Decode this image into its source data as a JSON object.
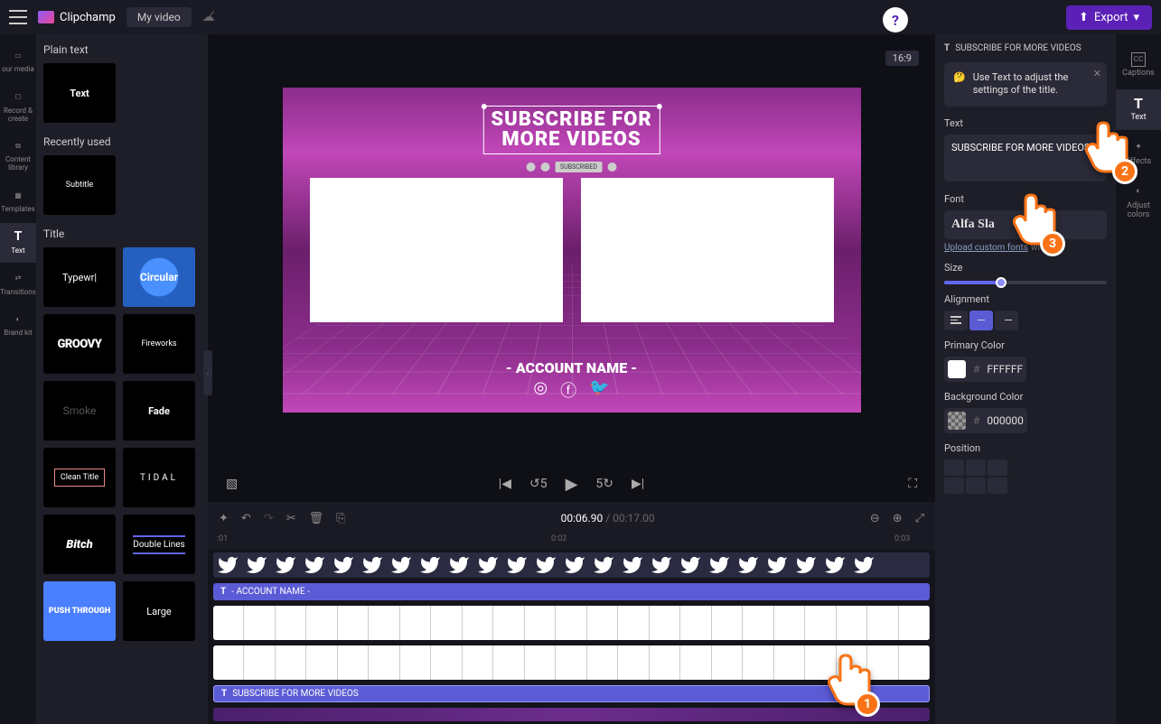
{
  "app_name": "Clipchamp",
  "video_name": "My video",
  "export_label": "Export",
  "rail": [
    {
      "icon": "film",
      "label": "our media"
    },
    {
      "icon": "video",
      "label": "Record & create"
    },
    {
      "icon": "library",
      "label": "Content library"
    },
    {
      "icon": "grid",
      "label": "Templates"
    },
    {
      "icon": "T",
      "label": "Text",
      "active": true
    },
    {
      "icon": "arrows",
      "label": "Transitions"
    },
    {
      "icon": "palette",
      "label": "Brand kit"
    }
  ],
  "left_panel": {
    "sections": {
      "plain": {
        "title": "Plain text",
        "items": [
          {
            "label": "Text"
          }
        ]
      },
      "recent": {
        "title": "Recently used",
        "items": [
          {
            "label": "Subtitle"
          }
        ]
      },
      "title": {
        "title": "Title",
        "items": [
          {
            "label": "Typewr",
            "cls": ""
          },
          {
            "label": "Circular",
            "cls": "circular"
          },
          {
            "label": "GROOVY",
            "cls": "groovy"
          },
          {
            "label": "Fireworks",
            "cls": ""
          },
          {
            "label": "Smoke",
            "cls": "smoke"
          },
          {
            "label": "Fade",
            "cls": ""
          },
          {
            "label": "Clean Title",
            "cls": "clean"
          },
          {
            "label": "TIDAL",
            "cls": "tidal"
          },
          {
            "label": "Bitch",
            "cls": "bitch"
          },
          {
            "label": "Double Lines",
            "cls": "double"
          },
          {
            "label": "PUSH THROUGH",
            "cls": "push"
          },
          {
            "label": "Large",
            "cls": ""
          }
        ]
      }
    }
  },
  "preview": {
    "aspect": "16:9",
    "title_line1": "SUBSCRIBE FOR",
    "title_line2": "MORE VIDEOS",
    "subscribed_label": "SUBSCRIBED",
    "account_text": "- ACCOUNT NAME -"
  },
  "timecode": {
    "current": "00:06.90",
    "duration": "00:17.00"
  },
  "ruler_marks": [
    ":01",
    "0:02",
    "0:03"
  ],
  "timeline_tracks": {
    "account_label": "- ACCOUNT NAME -",
    "subscribe_label": "SUBSCRIBE FOR MORE VIDEOS"
  },
  "right_panel": {
    "header": "SUBSCRIBE FOR MORE VIDEOS",
    "tip": "Use Text to adjust the settings of the title.",
    "text_label": "Text",
    "text_value": "SUBSCRIBE FOR MORE VIDEOS",
    "font_label": "Font",
    "font_value": "Alfa Sla",
    "upload_link": "Upload custom fonts",
    "upload_suffix": " with bra",
    "size_label": "Size",
    "alignment_label": "Alignment",
    "primary_label": "Primary Color",
    "primary_hex": "FFFFFF",
    "bg_label": "Background Color",
    "bg_hex": "000000",
    "position_label": "Position"
  },
  "right_rail": [
    {
      "label": "Captions",
      "icon": "cc"
    },
    {
      "label": "Text",
      "icon": "T",
      "active": true
    },
    {
      "label": "Effects",
      "icon": "wand"
    },
    {
      "label": "Adjust colors",
      "icon": "contrast"
    }
  ],
  "pointers": {
    "p1": "1",
    "p2": "2",
    "p3": "3"
  }
}
